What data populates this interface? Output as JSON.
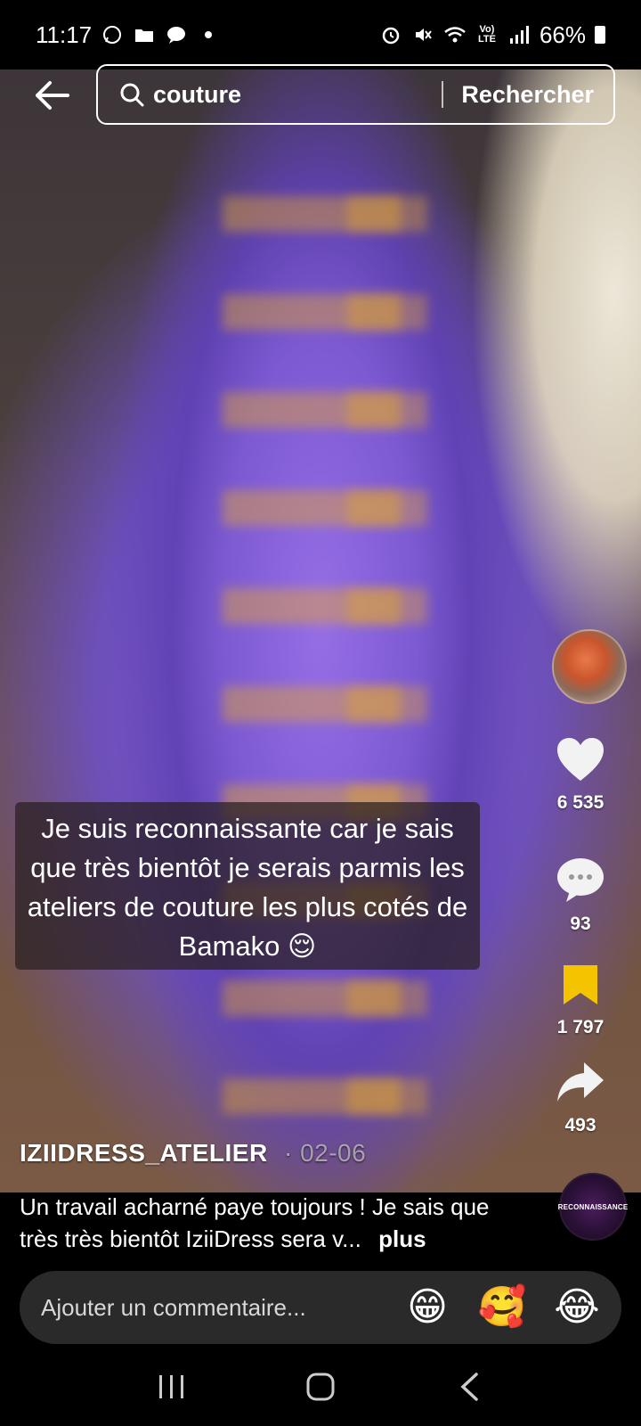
{
  "status_bar": {
    "time": "11:17",
    "network": "Vo) LTE",
    "battery": "66%"
  },
  "search": {
    "query": "couture",
    "submit_label": "Rechercher"
  },
  "caption": {
    "text": "Je suis reconnaissante car je sais que très bientôt je serais parmis les ateliers de couture les plus cotés de Bamako 😌"
  },
  "actions": {
    "likes": "6 535",
    "comments": "93",
    "saves": "1 797",
    "shares": "493"
  },
  "post": {
    "author": "IZIIDRESS_ATELIER",
    "date": "· 02-06",
    "description": "Un travail acharné paye toujours ! Je sais que très très bientôt IziiDress sera v...",
    "more_label": "plus",
    "sound_label": "RECONNAISSANCE"
  },
  "comment_bar": {
    "placeholder": "Ajouter un commentaire...",
    "emojis": [
      "😁",
      "🥰",
      "😂"
    ]
  },
  "colors": {
    "accent_save": "#f5c400",
    "dress_purple": "#8a62d8",
    "embroidery_gold": "#e2a52a"
  }
}
